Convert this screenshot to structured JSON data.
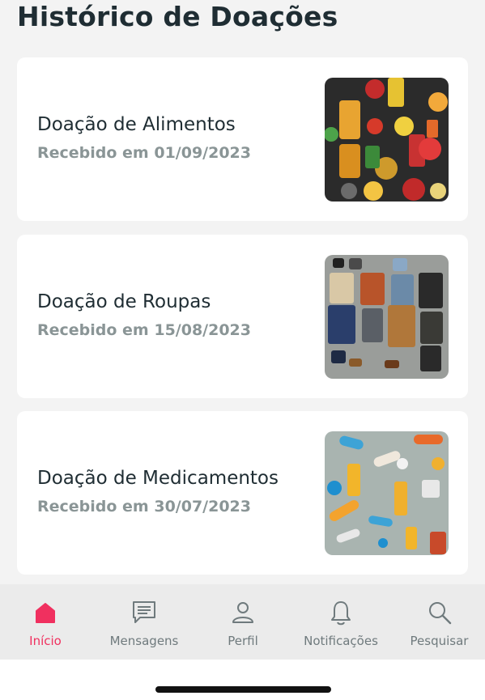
{
  "header": {
    "title": "Histórico de Doações"
  },
  "donations": [
    {
      "title": "Doação de Alimentos",
      "date": "Recebido em 01/09/2023",
      "image": "food-image"
    },
    {
      "title": "Doação de Roupas",
      "date": "Recebido em 15/08/2023",
      "image": "clothes-image"
    },
    {
      "title": "Doação de Medicamentos",
      "date": "Recebido em 30/07/2023",
      "image": "medicine-image"
    }
  ],
  "tabbar": {
    "active_color": "#f0305f",
    "items": [
      {
        "label": "Início",
        "icon": "home-icon",
        "active": true
      },
      {
        "label": "Mensagens",
        "icon": "message-icon",
        "active": false
      },
      {
        "label": "Perfil",
        "icon": "user-icon",
        "active": false
      },
      {
        "label": "Notificações",
        "icon": "bell-icon",
        "active": false
      },
      {
        "label": "Pesquisar",
        "icon": "search-icon",
        "active": false
      }
    ]
  }
}
